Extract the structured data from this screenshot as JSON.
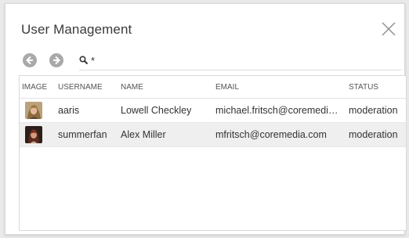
{
  "dialog": {
    "title": "User Management"
  },
  "toolbar": {
    "back_icon": "arrow-left-circle-icon",
    "forward_icon": "arrow-right-circle-icon",
    "search_icon": "search-icon",
    "search_value": "*"
  },
  "table": {
    "columns": [
      "IMAGE",
      "USERNAME",
      "NAME",
      "EMAIL",
      "STATUS"
    ],
    "rows": [
      {
        "username": "aaris",
        "name": "Lowell Checkley",
        "email": "michael.fritsch@coremedia.c...",
        "status": "moderation"
      },
      {
        "username": "summerfan",
        "name": "Alex Miller",
        "email": "mfritsch@coremedia.com",
        "status": "moderation"
      }
    ],
    "selected_row": 1
  },
  "colors": {
    "icon_gray": "#a9a9a9",
    "selected_row_bg": "#efefef"
  }
}
